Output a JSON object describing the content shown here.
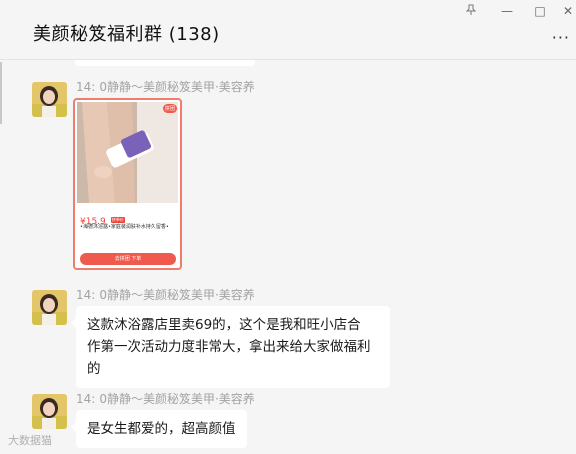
{
  "header": {
    "title": "美颜秘笈福利群 (138)",
    "more_label": "···",
    "window_controls": {
      "pin_icon": "pin-icon",
      "minimize": "—",
      "maximize": "□",
      "close": "✕"
    }
  },
  "messages": [
    {
      "time": "14:",
      "sender": "0静静～美颜秘笈美甲·美容养",
      "type": "product-card",
      "card": {
        "tag": "拼团",
        "price": "¥15.9",
        "price_tag": "拼单价",
        "description": "•海德沐浴露•家庭装润肤补水持久留香•",
        "button": "去拼团 下单"
      }
    },
    {
      "time": "14:",
      "sender": "0静静～美颜秘笈美甲·美容养",
      "type": "text",
      "lines": [
        "这款沐浴露店里卖69的，这个是我和旺小店合",
        "作第一次活动力度非常大，拿出来给大家做福利",
        "的"
      ]
    },
    {
      "time": "14:",
      "sender": "0静静～美颜秘笈美甲·美容养",
      "type": "text",
      "lines": [
        "是女生都爱的，超高颜值"
      ]
    }
  ],
  "watermark": "大数据猫",
  "colors": {
    "background": "#f5f5f5",
    "bubble": "#ffffff",
    "card_border": "#ef7c6c",
    "price_red": "#f0433a"
  }
}
